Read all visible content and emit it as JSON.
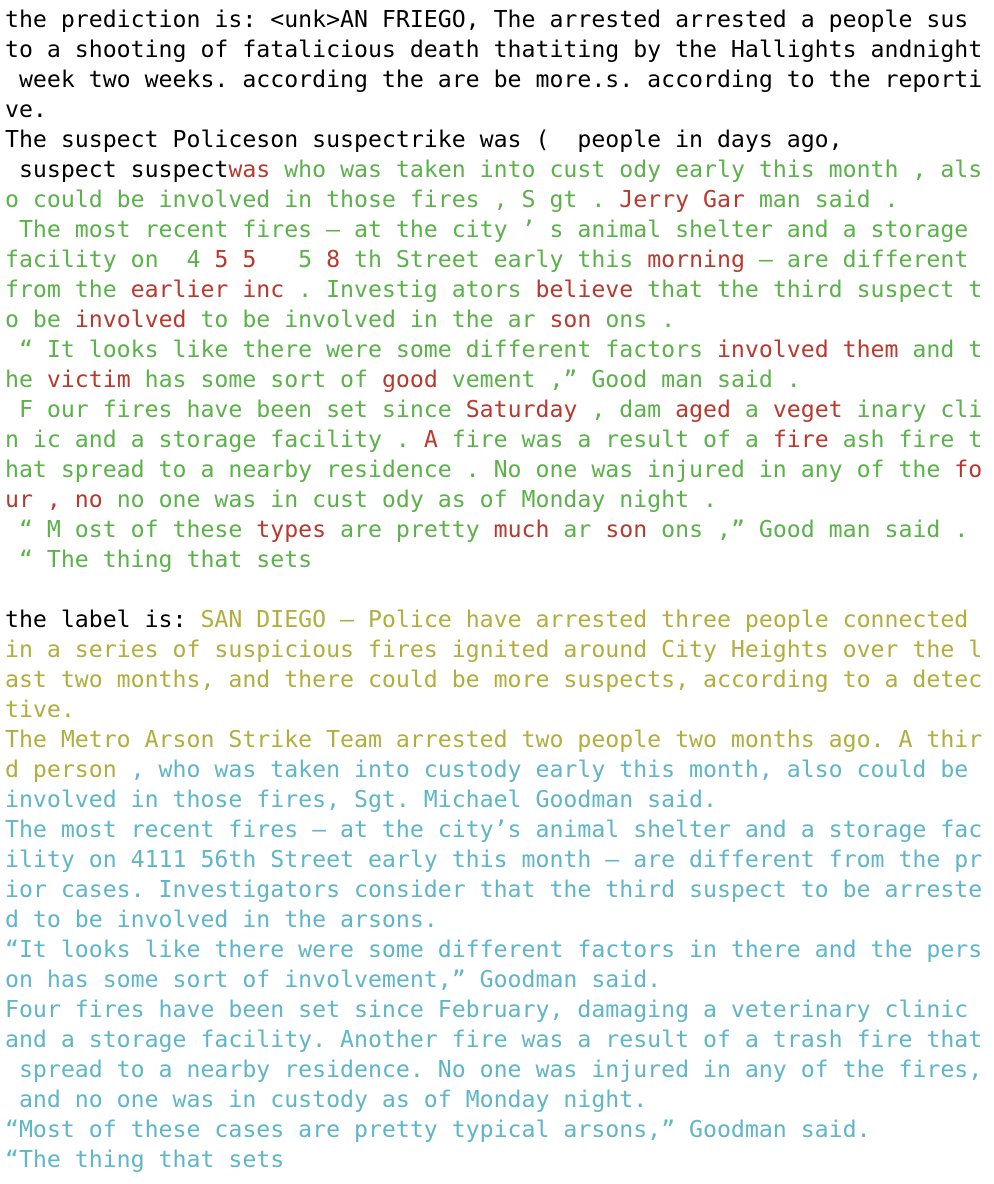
{
  "colors": {
    "plain": "#000000",
    "mismatch_red": "#b73a2f",
    "match_green": "#5bb24a",
    "label_olive": "#b1ae3e",
    "label_cyan": "#5fb6c7"
  },
  "lines": [
    [
      [
        "k",
        "the prediction is: <unk>AN FRIEGO, The arrested arrested a people sus"
      ]
    ],
    [
      [
        "k",
        "to a shooting of fatalicious death thatiting by the Hallights andnight"
      ]
    ],
    [
      [
        "k",
        " week two weeks. according the are be more.s. according to the reporti"
      ]
    ],
    [
      [
        "k",
        "ve."
      ]
    ],
    [
      [
        "k",
        "The suspect Policeson suspectrike was (  people in days ago,"
      ]
    ],
    [
      [
        "k",
        " suspect suspect"
      ],
      [
        "r",
        "was"
      ],
      [
        "g",
        " who was taken into cust ody early this month , als"
      ]
    ],
    [
      [
        "g",
        "o could be involved in those fires , S gt . "
      ],
      [
        "r",
        "Jerry Gar"
      ],
      [
        "g",
        " man said ."
      ]
    ],
    [
      [
        "g",
        " The most recent fires — at the city ’ s animal shelter and a storage"
      ]
    ],
    [
      [
        "g",
        "facility on  4 "
      ],
      [
        "r",
        "5 5"
      ],
      [
        "g",
        "   5 "
      ],
      [
        "r",
        "8"
      ],
      [
        "g",
        " th Street early this "
      ],
      [
        "r",
        "morning"
      ],
      [
        "g",
        " — are different"
      ]
    ],
    [
      [
        "g",
        "from the "
      ],
      [
        "r",
        "earlier inc"
      ],
      [
        "g",
        " . Investig ators "
      ],
      [
        "r",
        "believe"
      ],
      [
        "g",
        " that the third suspect t"
      ]
    ],
    [
      [
        "g",
        "o be "
      ],
      [
        "r",
        "involved"
      ],
      [
        "g",
        " to be involved in the ar "
      ],
      [
        "r",
        "son"
      ],
      [
        "g",
        " ons ."
      ]
    ],
    [
      [
        "g",
        " “ It looks like there were some different factors "
      ],
      [
        "r",
        "involved them"
      ],
      [
        "g",
        " and t"
      ]
    ],
    [
      [
        "g",
        "he "
      ],
      [
        "r",
        "victim"
      ],
      [
        "g",
        " has some sort of "
      ],
      [
        "r",
        "good"
      ],
      [
        "g",
        " vement ,” Good man said ."
      ]
    ],
    [
      [
        "g",
        " F our fires have been set since "
      ],
      [
        "r",
        "Saturday"
      ],
      [
        "g",
        " , dam "
      ],
      [
        "r",
        "aged"
      ],
      [
        "g",
        " a "
      ],
      [
        "r",
        "veget"
      ],
      [
        "g",
        " inary cli"
      ]
    ],
    [
      [
        "g",
        "n ic and a storage facility . "
      ],
      [
        "r",
        "A"
      ],
      [
        "g",
        " fire was a result of a "
      ],
      [
        "r",
        "fire"
      ],
      [
        "g",
        " ash fire t"
      ]
    ],
    [
      [
        "g",
        "hat spread to a nearby residence . No one was injured in any of the "
      ],
      [
        "r",
        "fo"
      ]
    ],
    [
      [
        "r",
        "ur , no"
      ],
      [
        "g",
        " no one was in cust ody as of Monday night ."
      ]
    ],
    [
      [
        "g",
        " “ M ost of these "
      ],
      [
        "r",
        "types"
      ],
      [
        "g",
        " are pretty "
      ],
      [
        "r",
        "much"
      ],
      [
        "g",
        " ar "
      ],
      [
        "r",
        "son"
      ],
      [
        "g",
        " ons ,” Good man said ."
      ]
    ],
    [
      [
        "g",
        " “ The thing that sets"
      ]
    ],
    [
      [
        "k",
        ""
      ]
    ],
    [
      [
        "k",
        "the label is: "
      ],
      [
        "o",
        "SAN DIEGO — Police have arrested three people connected"
      ]
    ],
    [
      [
        "o",
        "in a series of suspicious fires ignited around City Heights over the l"
      ]
    ],
    [
      [
        "o",
        "ast two months, and there could be more suspects, according to a detec"
      ]
    ],
    [
      [
        "o",
        "tive."
      ]
    ],
    [
      [
        "o",
        "The Metro Arson Strike Team arrested two people two months ago. A thir"
      ]
    ],
    [
      [
        "o",
        "d person "
      ],
      [
        "c",
        ", who was taken into custody early this month, also could be"
      ]
    ],
    [
      [
        "c",
        "involved in those fires, Sgt. Michael Goodman said."
      ]
    ],
    [
      [
        "c",
        "The most recent fires — at the city’s animal shelter and a storage fac"
      ]
    ],
    [
      [
        "c",
        "ility on 4111 56th Street early this month — are different from the pr"
      ]
    ],
    [
      [
        "c",
        "ior cases. Investigators consider that the third suspect to be arreste"
      ]
    ],
    [
      [
        "c",
        "d to be involved in the arsons."
      ]
    ],
    [
      [
        "c",
        "“It looks like there were some different factors in there and the pers"
      ]
    ],
    [
      [
        "c",
        "on has some sort of involvement,” Goodman said."
      ]
    ],
    [
      [
        "c",
        "Four fires have been set since February, damaging a veterinary clinic"
      ]
    ],
    [
      [
        "c",
        "and a storage facility. Another fire was a result of a trash fire that"
      ]
    ],
    [
      [
        "c",
        " spread to a nearby residence. No one was injured in any of the fires,"
      ]
    ],
    [
      [
        "c",
        " and no one was in custody as of Monday night."
      ]
    ],
    [
      [
        "c",
        "“Most of these cases are pretty typical arsons,” Goodman said."
      ]
    ],
    [
      [
        "c",
        "“The thing that sets"
      ]
    ]
  ]
}
